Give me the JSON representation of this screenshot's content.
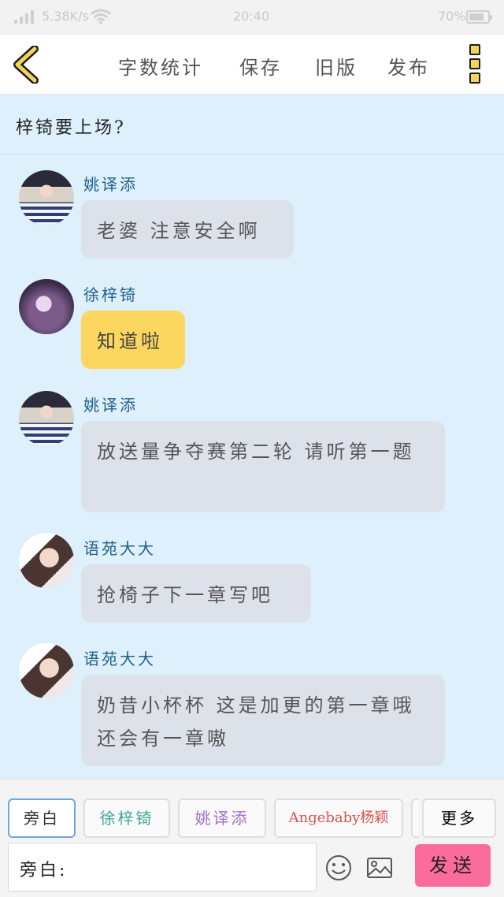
{
  "status_bar": {
    "speed": "5.38K/s",
    "time": "20:40",
    "battery": "70%"
  },
  "toolbar": {
    "word_count": "字数统计",
    "save": "保存",
    "old_version": "旧版",
    "publish": "发布"
  },
  "title": "梓锜要上场?",
  "messages": [
    {
      "sender": "姚译添",
      "text": "老婆 注意安全啊",
      "avatar": "yao"
    },
    {
      "sender": "徐梓锜",
      "text": "知道啦",
      "avatar": "xu"
    },
    {
      "sender": "姚译添",
      "text": "放送量争夺赛第二轮 请听第一题",
      "avatar": "yao"
    },
    {
      "sender": "语苑大大",
      "text": "抢椅子下一章写吧",
      "avatar": "yu"
    },
    {
      "sender": "语苑大大",
      "text": "奶昔小杯杯 这是加更的第一章哦 还会有一章嗷",
      "avatar": "yu"
    }
  ],
  "roles": [
    {
      "label": "旁白",
      "color": "#333333"
    },
    {
      "label": "徐梓锜",
      "color": "#3aa89a"
    },
    {
      "label": "姚译添",
      "color": "#a46fc8"
    },
    {
      "label": "Angebaby杨颖",
      "color": "#d9534f"
    },
    {
      "label": "更多",
      "color": "#333333"
    }
  ],
  "input": {
    "value": "旁白:"
  },
  "send_label": "发送",
  "colors": {
    "background": "#ddf0fb",
    "bubble": "#dde2ea",
    "highlight_bubble": "#fbd75f",
    "send": "#fb6c9c",
    "sender": "#1f5f8b"
  }
}
